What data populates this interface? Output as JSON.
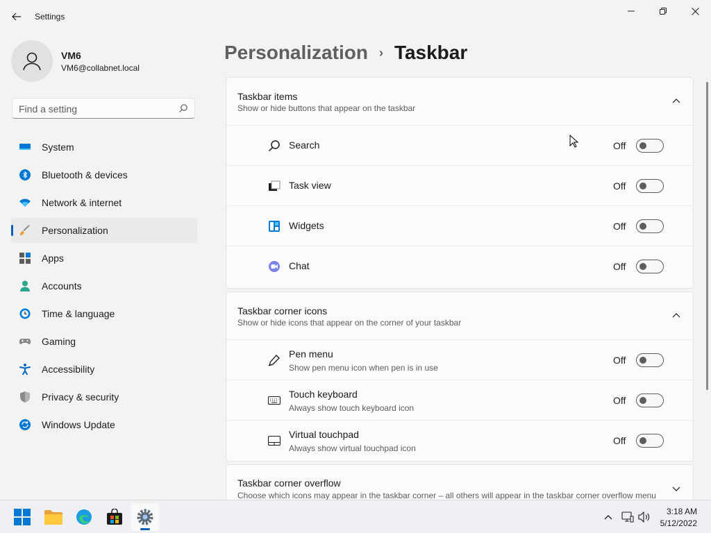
{
  "window": {
    "title": "Settings"
  },
  "profile": {
    "name": "VM6",
    "email": "VM6@collabnet.local"
  },
  "search": {
    "placeholder": "Find a setting"
  },
  "nav": {
    "items": [
      {
        "label": "System",
        "icon": "system-icon"
      },
      {
        "label": "Bluetooth & devices",
        "icon": "bluetooth-icon"
      },
      {
        "label": "Network & internet",
        "icon": "wifi-icon"
      },
      {
        "label": "Personalization",
        "icon": "brush-icon",
        "selected": true
      },
      {
        "label": "Apps",
        "icon": "apps-icon"
      },
      {
        "label": "Accounts",
        "icon": "accounts-icon"
      },
      {
        "label": "Time & language",
        "icon": "clock-icon"
      },
      {
        "label": "Gaming",
        "icon": "gamepad-icon"
      },
      {
        "label": "Accessibility",
        "icon": "accessibility-icon"
      },
      {
        "label": "Privacy & security",
        "icon": "shield-icon"
      },
      {
        "label": "Windows Update",
        "icon": "update-icon"
      }
    ]
  },
  "breadcrumb": {
    "parent": "Personalization",
    "separator": "›",
    "current": "Taskbar"
  },
  "taskbar_items": {
    "title": "Taskbar items",
    "subtitle": "Show or hide buttons that appear on the taskbar",
    "rows": [
      {
        "label": "Search",
        "state": "Off",
        "icon": "search-icon"
      },
      {
        "label": "Task view",
        "state": "Off",
        "icon": "task-view-icon"
      },
      {
        "label": "Widgets",
        "state": "Off",
        "icon": "widgets-icon"
      },
      {
        "label": "Chat",
        "state": "Off",
        "icon": "chat-icon"
      }
    ]
  },
  "corner_icons": {
    "title": "Taskbar corner icons",
    "subtitle": "Show or hide icons that appear on the corner of your taskbar",
    "rows": [
      {
        "label": "Pen menu",
        "desc": "Show pen menu icon when pen is in use",
        "state": "Off",
        "icon": "pen-icon"
      },
      {
        "label": "Touch keyboard",
        "desc": "Always show touch keyboard icon",
        "state": "Off",
        "icon": "keyboard-icon"
      },
      {
        "label": "Virtual touchpad",
        "desc": "Always show virtual touchpad icon",
        "state": "Off",
        "icon": "touchpad-icon"
      }
    ]
  },
  "corner_overflow": {
    "title": "Taskbar corner overflow",
    "subtitle": "Choose which icons may appear in the taskbar corner – all others will appear in the taskbar corner overflow menu"
  },
  "system_taskbar": {
    "time": "3:18 AM",
    "date": "5/12/2022"
  },
  "colors": {
    "accent": "#005fb8",
    "window_bg": "#f3f3f3",
    "card_bg": "#fbfbfb"
  }
}
